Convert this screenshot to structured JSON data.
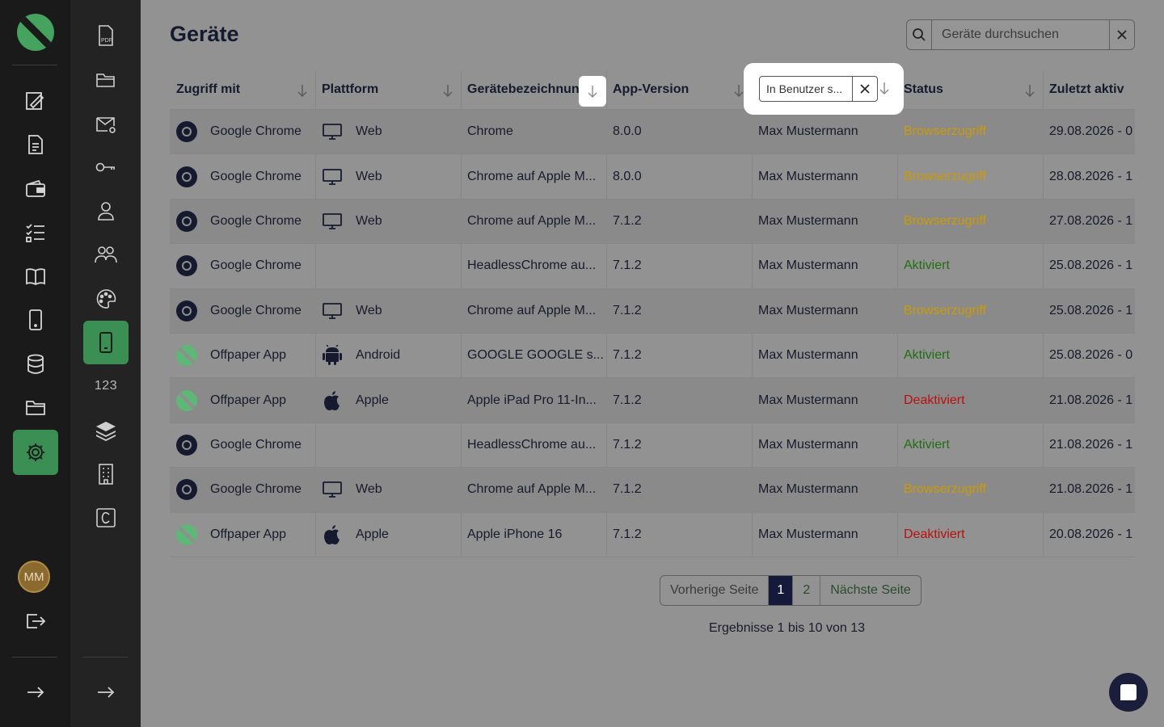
{
  "page": {
    "title": "Geräte"
  },
  "search": {
    "placeholder": "Geräte durchsuchen"
  },
  "rail2": {
    "counter_label": "123"
  },
  "user": {
    "initials": "MM"
  },
  "table": {
    "columns": [
      "Zugriff mit",
      "Plattform",
      "Gerätebezeichnung",
      "App-Version",
      "",
      "Status",
      "Zuletzt aktiv"
    ],
    "filter_value": "In Benutzer s...",
    "rows": [
      {
        "access": "Google Chrome",
        "access_icon": "chrome-icon",
        "platform": "Web",
        "platform_icon": "desktop-icon",
        "device": "Chrome",
        "version": "8.0.0",
        "user": "Max Mustermann",
        "status": "Browserzugriff",
        "status_kind": "browser",
        "last": "29.08.2026 - 0"
      },
      {
        "access": "Google Chrome",
        "access_icon": "chrome-icon",
        "platform": "Web",
        "platform_icon": "desktop-icon",
        "device": "Chrome auf Apple M...",
        "version": "8.0.0",
        "user": "Max Mustermann",
        "status": "Browserzugriff",
        "status_kind": "browser",
        "last": "28.08.2026 - 1"
      },
      {
        "access": "Google Chrome",
        "access_icon": "chrome-icon",
        "platform": "Web",
        "platform_icon": "desktop-icon",
        "device": "Chrome auf Apple M...",
        "version": "7.1.2",
        "user": "Max Mustermann",
        "status": "Browserzugriff",
        "status_kind": "browser",
        "last": "27.08.2026 - 1"
      },
      {
        "access": "Google Chrome",
        "access_icon": "chrome-icon",
        "platform": "",
        "platform_icon": "",
        "device": "HeadlessChrome au...",
        "version": "7.1.2",
        "user": "Max Mustermann",
        "status": "Aktiviert",
        "status_kind": "active",
        "last": "25.08.2026 - 1"
      },
      {
        "access": "Google Chrome",
        "access_icon": "chrome-icon",
        "platform": "Web",
        "platform_icon": "desktop-icon",
        "device": "Chrome auf Apple M...",
        "version": "7.1.2",
        "user": "Max Mustermann",
        "status": "Browserzugriff",
        "status_kind": "browser",
        "last": "25.08.2026 - 1"
      },
      {
        "access": "Offpaper App",
        "access_icon": "offpaper-icon",
        "platform": "Android",
        "platform_icon": "android-icon",
        "device": "GOOGLE GOOGLE s...",
        "version": "7.1.2",
        "user": "Max Mustermann",
        "status": "Aktiviert",
        "status_kind": "active",
        "last": "25.08.2026 - 0"
      },
      {
        "access": "Offpaper App",
        "access_icon": "offpaper-icon",
        "platform": "Apple",
        "platform_icon": "apple-icon",
        "device": "Apple iPad Pro 11-In...",
        "version": "7.1.2",
        "user": "Max Mustermann",
        "status": "Deaktiviert",
        "status_kind": "deactive",
        "last": "21.08.2026 - 1"
      },
      {
        "access": "Google Chrome",
        "access_icon": "chrome-icon",
        "platform": "",
        "platform_icon": "",
        "device": "HeadlessChrome au...",
        "version": "7.1.2",
        "user": "Max Mustermann",
        "status": "Aktiviert",
        "status_kind": "active",
        "last": "21.08.2026 - 1"
      },
      {
        "access": "Google Chrome",
        "access_icon": "chrome-icon",
        "platform": "Web",
        "platform_icon": "desktop-icon",
        "device": "Chrome auf Apple M...",
        "version": "7.1.2",
        "user": "Max Mustermann",
        "status": "Browserzugriff",
        "status_kind": "browser",
        "last": "21.08.2026 - 1"
      },
      {
        "access": "Offpaper App",
        "access_icon": "offpaper-icon",
        "platform": "Apple",
        "platform_icon": "apple-icon",
        "device": "Apple iPhone 16",
        "version": "7.1.2",
        "user": "Max Mustermann",
        "status": "Deaktiviert",
        "status_kind": "deactive",
        "last": "20.08.2026 - 1"
      }
    ]
  },
  "pagination": {
    "prev": "Vorherige Seite",
    "page1": "1",
    "page2": "2",
    "next": "Nächste Seite",
    "results": "Ergebnisse 1 bis 10 von 13"
  },
  "colors": {
    "browser": "#cc9a06",
    "active": "#1f6e12",
    "deactive": "#b8110f",
    "accent": "#3b8f55"
  }
}
